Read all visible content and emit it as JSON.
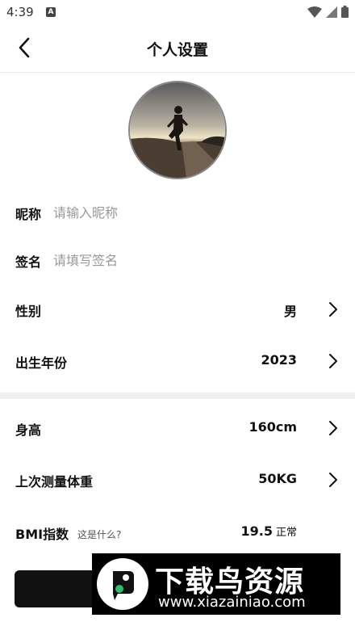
{
  "status_bar": {
    "time": "4:39",
    "notification_icon": "A"
  },
  "header": {
    "title": "个人设置"
  },
  "profile": {
    "nickname_label": "昵称",
    "nickname_placeholder": "请输入昵称",
    "signature_label": "签名",
    "signature_placeholder": "请填写签名",
    "gender_label": "性别",
    "gender_value": "男",
    "birth_year_label": "出生年份",
    "birth_year_value": "2023"
  },
  "body_data": {
    "height_label": "身高",
    "height_value": "160cm",
    "weight_label": "上次测量体重",
    "weight_value": "50KG",
    "bmi_label": "BMI指数",
    "bmi_hint": "这是什么?",
    "bmi_value": "19.5",
    "bmi_status": "正常"
  },
  "watermark": {
    "text": "下载鸟资源",
    "url": "www.xiazainiao.com"
  },
  "colors": {
    "primary": "#111111",
    "divider": "#f0f0f0",
    "placeholder": "#999999"
  }
}
